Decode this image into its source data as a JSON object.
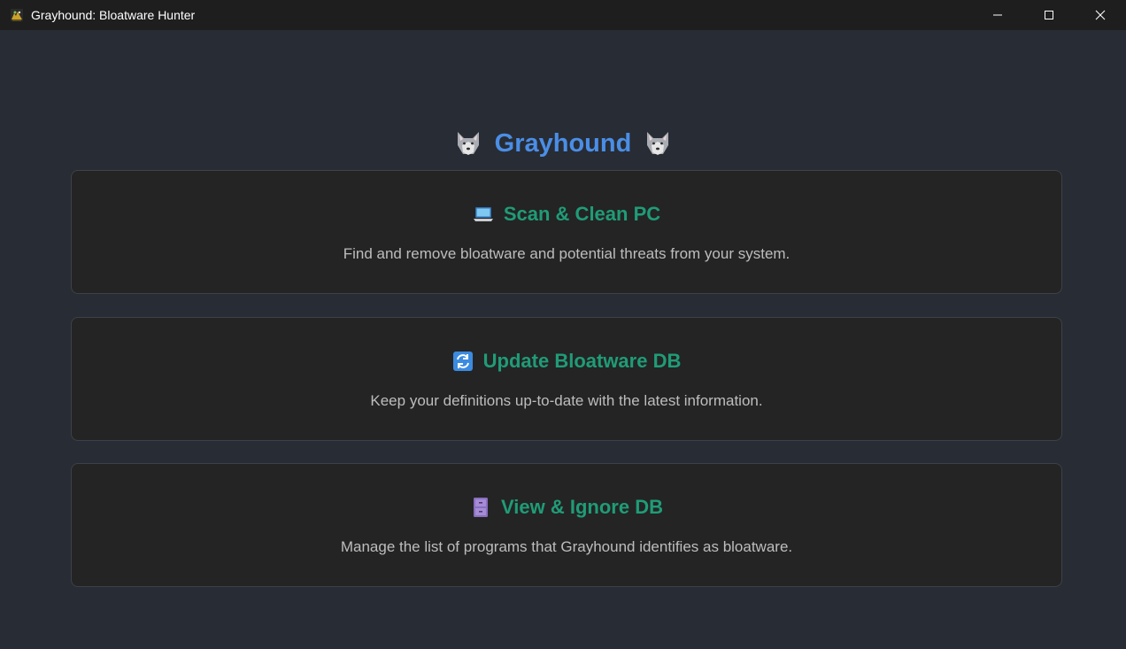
{
  "window": {
    "title": "Grayhound: Bloatware Hunter",
    "icon": "grayhound-app-icon",
    "controls": {
      "minimize": "minimize-icon",
      "maximize": "maximize-icon",
      "close": "close-icon"
    }
  },
  "header": {
    "title": "Grayhound",
    "left_emoji": "🐺",
    "right_emoji": "🐺",
    "color": "#4a8ee6"
  },
  "cards": [
    {
      "icon": "laptop-icon",
      "title": "Scan & Clean PC",
      "description": "Find and remove bloatware and potential threats from your system."
    },
    {
      "icon": "refresh-icon",
      "title": "Update Bloatware DB",
      "description": "Keep your definitions up-to-date with the latest information."
    },
    {
      "icon": "file-cabinet-icon",
      "title": "View & Ignore DB",
      "description": "Manage the list of programs that Grayhound identifies as bloatware."
    }
  ],
  "colors": {
    "background": "#282c34",
    "titlebar": "#1e1e1e",
    "card_background": "#242424",
    "card_title": "#1f9c77",
    "card_text": "#bdbdbd"
  }
}
